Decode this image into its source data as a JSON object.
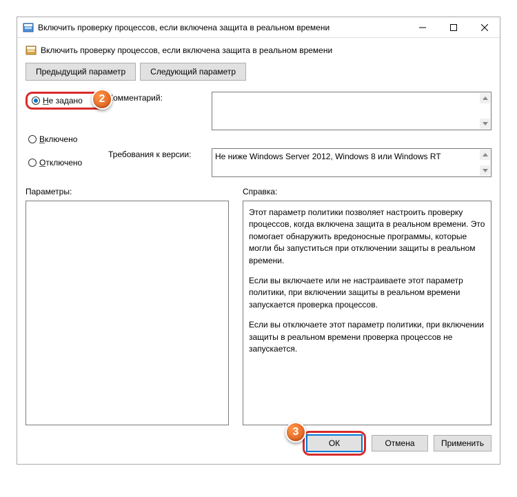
{
  "window": {
    "title": "Включить проверку процессов, если включена защита в реальном времени"
  },
  "subheader": {
    "text": "Включить проверку процессов, если включена защита в реальном времени"
  },
  "nav": {
    "prev": "Предыдущий параметр",
    "next": "Следующий параметр"
  },
  "radio": {
    "not_configured": "Не задано",
    "enabled": "Включено",
    "disabled": "Отключено"
  },
  "fields": {
    "comment_label": "Комментарий:",
    "requirements_label": "Требования к версии:",
    "requirements_value": "Не ниже Windows Server 2012, Windows 8 или Windows RT"
  },
  "columns": {
    "parameters_label": "Параметры:",
    "help_label": "Справка:"
  },
  "help": {
    "p1": "Этот параметр политики позволяет настроить проверку процессов, когда включена защита в реальном времени. Это помогает обнаружить вредоносные программы, которые могли бы запуститься при отключении защиты в реальном времени.",
    "p2": "Если вы включаете или не настраиваете этот параметр политики, при включении защиты в реальном времени запускается проверка процессов.",
    "p3": "Если вы отключаете этот параметр политики, при включении защиты в реальном времени проверка процессов не запускается."
  },
  "buttons": {
    "ok": "ОК",
    "cancel": "Отмена",
    "apply": "Применить"
  },
  "annotations": {
    "badge2": "2",
    "badge3": "3"
  }
}
